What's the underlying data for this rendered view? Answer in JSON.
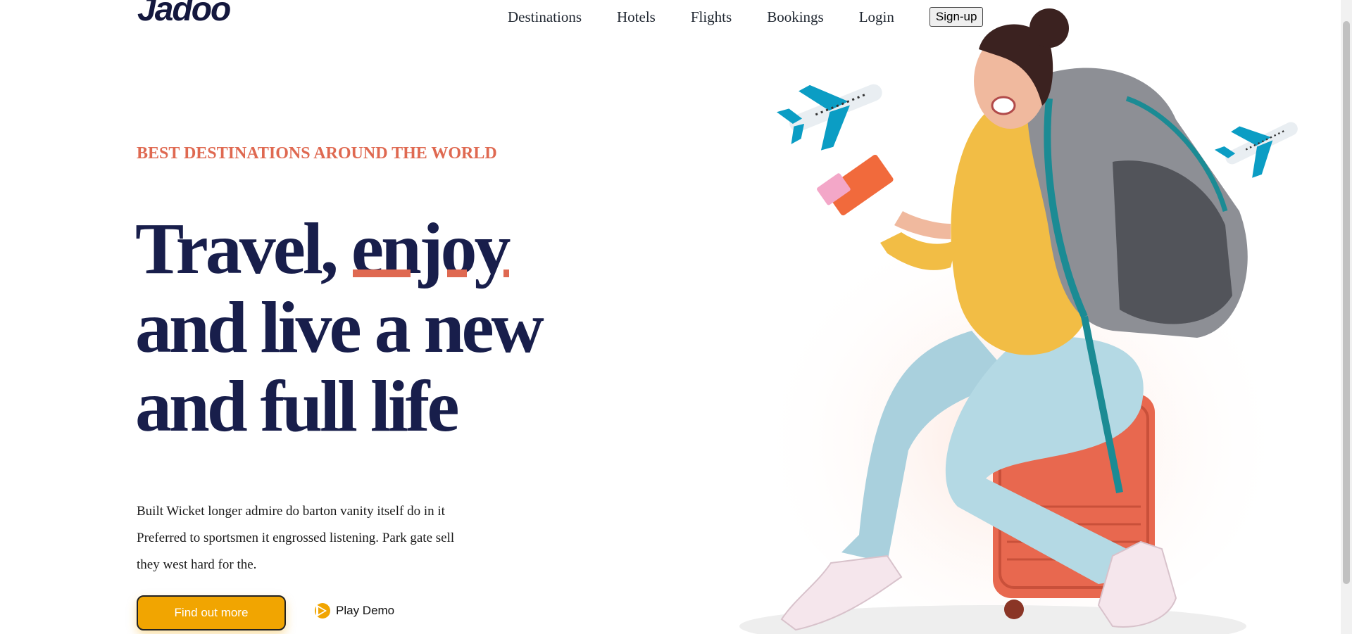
{
  "header": {
    "logo_text": "Jadoo",
    "nav": [
      "Destinations",
      "Hotels",
      "Flights",
      "Bookings",
      "Login"
    ],
    "signup_label": "Sign-up"
  },
  "hero": {
    "tagline": "BEST DESTINATIONS AROUND THE WORLD",
    "headline_line1_a": "Travel,",
    "headline_line1_b": "enjoy",
    "headline_line2": "and live a new",
    "headline_line3": "and full life",
    "description": "Built Wicket longer admire do barton vanity itself do in it Preferred to sportsmen it engrossed listening. Park gate sell they west hard for the.",
    "cta_label": "Find out more",
    "play_label": "Play Demo"
  },
  "colors": {
    "accent_orange": "#df6951",
    "brand_yellow": "#f1a501",
    "navy": "#181e4b",
    "plane_blue": "#0b9dc4"
  },
  "icons": [
    "play-icon",
    "airplane-icon",
    "traveler-illustration"
  ]
}
